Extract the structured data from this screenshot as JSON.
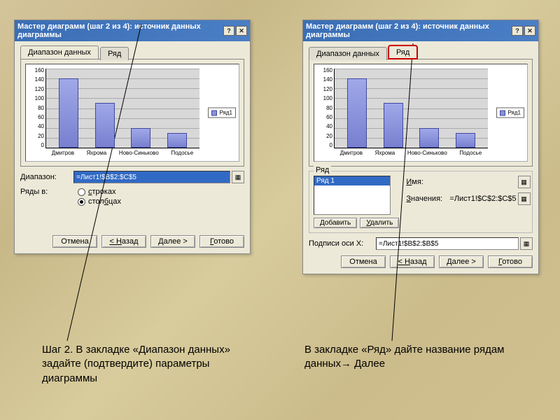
{
  "title": "Мастер диаграмм (шаг 2 из 4): источник данных диаграммы",
  "tabs": {
    "range": "Диапазон данных",
    "series": "Ряд"
  },
  "chart_data": {
    "type": "bar",
    "categories": [
      "Дмитров",
      "Яхрома",
      "Ново-Синьково",
      "Подосье"
    ],
    "values": [
      140,
      90,
      40,
      30
    ],
    "title": "",
    "xlabel": "",
    "ylabel": "",
    "ylim": [
      0,
      160
    ],
    "yticks": [
      0,
      20,
      40,
      60,
      80,
      100,
      120,
      140,
      160
    ],
    "series": [
      {
        "name": "Ряд1",
        "values": [
          140,
          90,
          40,
          30
        ]
      }
    ]
  },
  "legend_label": "Ряд1",
  "left": {
    "range_label": "Диапазон:",
    "range_value": "=Лист1!$B$2:$C$5",
    "rows_in_label": "Ряды в:",
    "radio_rows": "строках",
    "radio_cols": "столбцах"
  },
  "right": {
    "series_group": "Ряд",
    "series_item": "Ряд 1",
    "name_label": "Имя:",
    "name_value": "",
    "values_label": "Значения:",
    "values_value": "=Лист1!$C$2:$C$5",
    "add_btn": "Добавить",
    "del_btn": "Удалить",
    "xlabels_label": "Подписи оси X:",
    "xlabels_value": "=Лист1!$B$2:$B$5"
  },
  "buttons": {
    "cancel": "Отмена",
    "back": "< Назад",
    "next": "Далее >",
    "finish": "Готово"
  },
  "captions": {
    "left": "Шаг 2. В закладке «Диапазон данных» задайте (подтвердите)   параметры диаграммы",
    "right": "В закладке «Ряд» дайте название рядам данных→ Далее"
  }
}
